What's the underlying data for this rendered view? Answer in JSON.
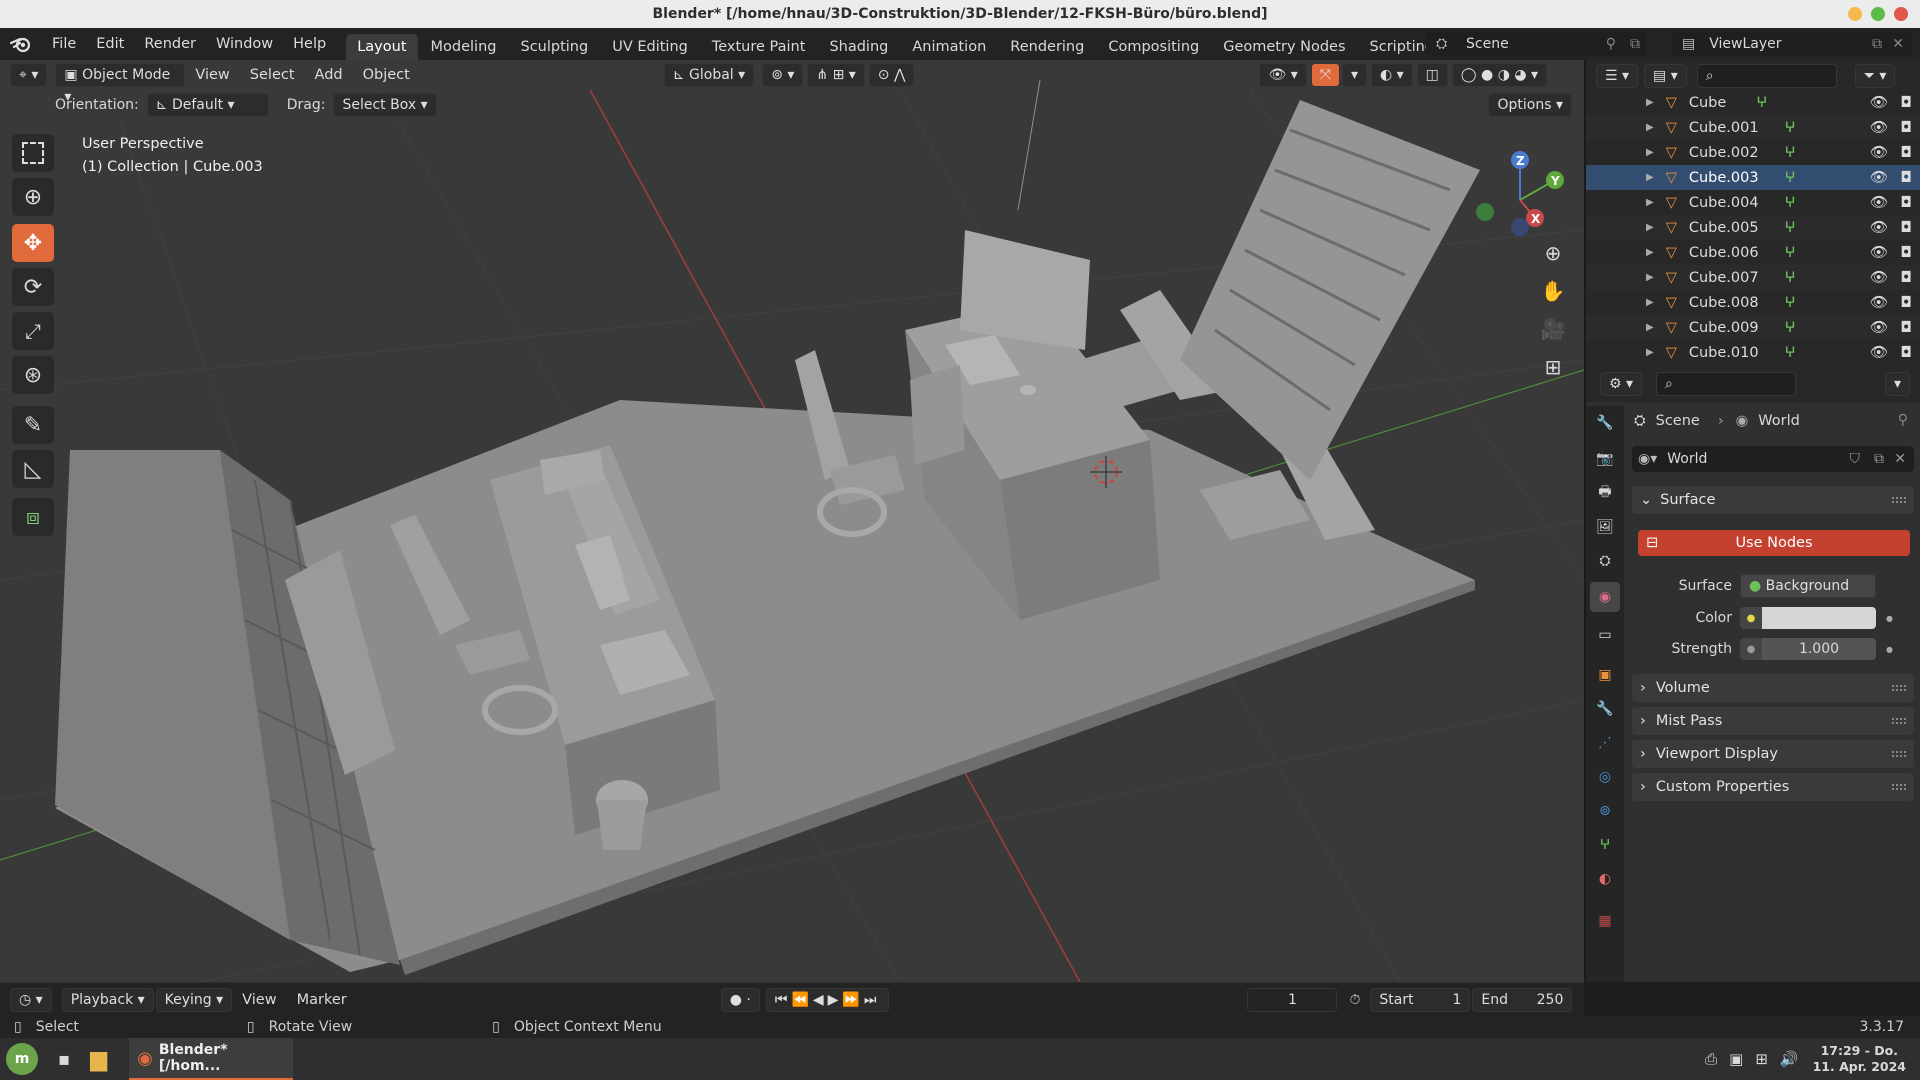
{
  "window": {
    "title": "Blender* [/home/hnau/3D-Construktion/3D-Blender/12-FKSH-Büro/büro.blend]"
  },
  "menubar": {
    "menus": [
      "File",
      "Edit",
      "Render",
      "Window",
      "Help"
    ],
    "workspaces": [
      "Layout",
      "Modeling",
      "Sculpting",
      "UV Editing",
      "Texture Paint",
      "Shading",
      "Animation",
      "Rendering",
      "Compositing",
      "Geometry Nodes",
      "Scripting"
    ],
    "active_workspace": "Layout",
    "scene_label": "Scene",
    "view_layer_label": "ViewLayer"
  },
  "viewport_header": {
    "mode": "Object Mode",
    "menus": [
      "View",
      "Select",
      "Add",
      "Object"
    ],
    "transform_orientation": "Global",
    "orientation_label": "Orientation:",
    "orientation_value": "Default",
    "drag_label": "Drag:",
    "drag_value": "Select Box",
    "options_label": "Options"
  },
  "viewport": {
    "perspective_text": "User Perspective",
    "collection_text": "(1) Collection | Cube.003",
    "gizmo_axes": {
      "x": "X",
      "y": "Y",
      "z": "Z"
    },
    "colors": {
      "background": "#393939",
      "object": "#8b8b8b",
      "x_axis": "#b03a3a",
      "y_axis": "#4f8a3a",
      "accent": "#e06a3c"
    }
  },
  "outliner": {
    "items": [
      "Cube",
      "Cube.001",
      "Cube.002",
      "Cube.003",
      "Cube.004",
      "Cube.005",
      "Cube.006",
      "Cube.007",
      "Cube.008",
      "Cube.009",
      "Cube.010"
    ],
    "selected": "Cube.003"
  },
  "properties": {
    "breadcrumb_scene": "Scene",
    "breadcrumb_world": "World",
    "world_name": "World",
    "surface_panel": "Surface",
    "use_nodes_button": "Use Nodes",
    "surface_label": "Surface",
    "surface_value": "Background",
    "color_label": "Color",
    "color_value": "#d6d6d6",
    "strength_label": "Strength",
    "strength_value": "1.000",
    "collapsed_panels": [
      "Volume",
      "Mist Pass",
      "Viewport Display",
      "Custom Properties"
    ]
  },
  "timeline": {
    "menus": [
      "Playback",
      "Keying",
      "View",
      "Marker"
    ],
    "current_frame": "1",
    "start_label": "Start",
    "start_value": "1",
    "end_label": "End",
    "end_value": "250"
  },
  "statusbar": {
    "select_hint": "Select",
    "rotate_hint": "Rotate View",
    "context_hint": "Object Context Menu",
    "version": "3.3.17"
  },
  "taskbar": {
    "app_label": "Blender* [/hom...",
    "time": "17:29 - Do.",
    "date": "11. Apr. 2024"
  }
}
